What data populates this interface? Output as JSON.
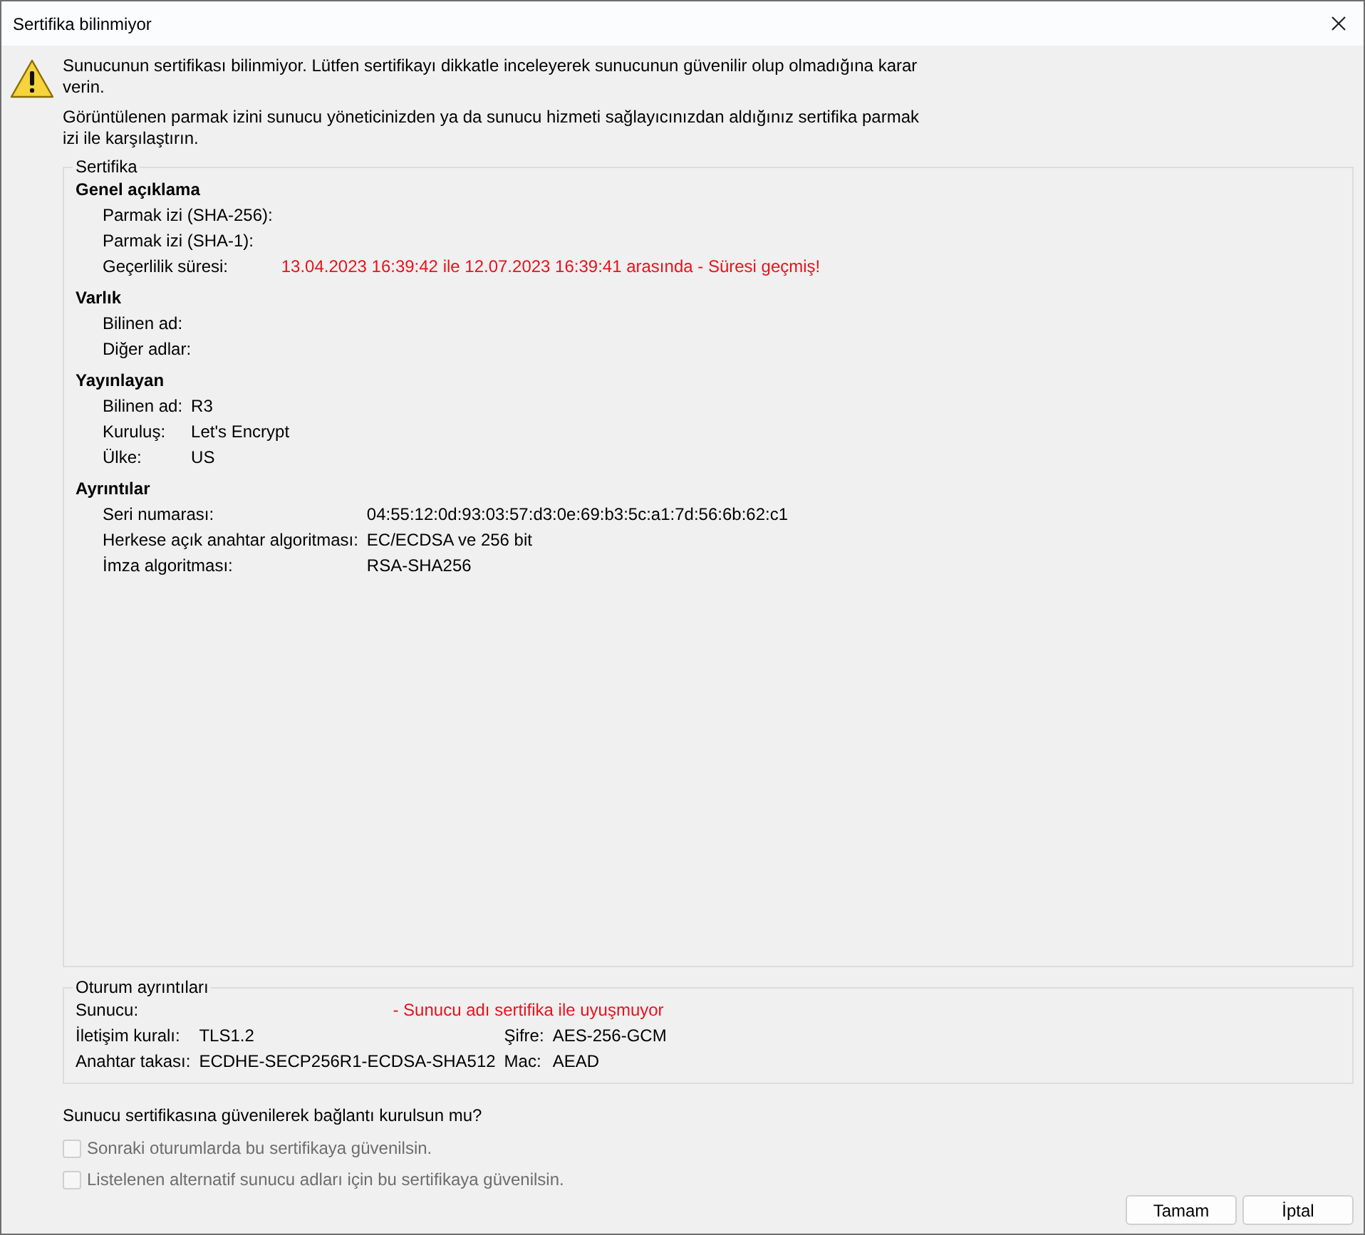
{
  "window": {
    "title": "Sertifika bilinmiyor"
  },
  "intro": [
    "Sunucunun sertifikası bilinmiyor. Lütfen sertifikayı dikkatle inceleyerek sunucunun güvenilir olup olmadığına karar verin.",
    "Görüntülenen parmak izini sunucu yöneticinizden ya da sunucu hizmeti sağlayıcınızdan aldığınız sertifika parmak izi ile karşılaştırın."
  ],
  "certificate": {
    "legend": "Sertifika",
    "sections": [
      {
        "heading": "Genel açıklama",
        "rows": [
          {
            "label": "Parmak izi (SHA-256):",
            "kind": "hidden"
          },
          {
            "label": "Parmak izi (SHA-1):",
            "kind": "hidden"
          },
          {
            "label": "Geçerlilik süresi:",
            "value": "13.04.2023 16:39:42 ile 12.07.2023 16:39:41 arasında - Süresi geçmiş!",
            "kind": "error"
          }
        ]
      },
      {
        "heading": "Varlık",
        "rows": [
          {
            "label": "Bilinen ad:",
            "kind": "hidden"
          },
          {
            "label": "Diğer adlar:",
            "kind": "hidden"
          }
        ]
      },
      {
        "heading": "Yayınlayan",
        "rows": [
          {
            "label": "Bilinen ad:",
            "value": "R3",
            "kind": "plain"
          },
          {
            "label": "Kuruluş:",
            "value": "Let's Encrypt",
            "kind": "plain"
          },
          {
            "label": "Ülke:",
            "value": "US",
            "kind": "plain"
          }
        ]
      },
      {
        "heading": "Ayrıntılar",
        "rows": [
          {
            "label": "Seri numarası:",
            "value": "04:55:12:0d:93:03:57:d3:0e:69:b3:5c:a1:7d:56:6b:62:c1",
            "kind": "plain"
          },
          {
            "label": "Herkese açık anahtar algoritması:",
            "value": "EC/ECDSA ve 256 bit",
            "kind": "plain"
          },
          {
            "label": "İmza algoritması:",
            "value": "RSA-SHA256",
            "kind": "plain"
          }
        ]
      }
    ]
  },
  "session": {
    "legend": "Oturum ayrıntıları",
    "server": {
      "label": "Sunucu:",
      "value": "- Sunucu adı sertifika ile uyuşmuyor",
      "kind": "error"
    },
    "rows": [
      {
        "label": "İletişim kuralı:",
        "value": "TLS1.2",
        "label2": "Şifre:",
        "value2": "AES-256-GCM"
      },
      {
        "label": "Anahtar takası:",
        "value": "ECDHE-SECP256R1-ECDSA-SHA512",
        "label2": "Mac:",
        "value2": "AEAD"
      }
    ]
  },
  "question": "Sunucu sertifikasına güvenilerek bağlantı kurulsun mu?",
  "checkboxes": [
    {
      "label": "Sonraki oturumlarda bu sertifikaya güvenilsin.",
      "checked": false,
      "disabled": true
    },
    {
      "label": "Listelenen alternatif sunucu adları için bu sertifikaya güvenilsin.",
      "checked": false,
      "disabled": true
    }
  ],
  "buttons": [
    "Tamam",
    "İptal"
  ]
}
